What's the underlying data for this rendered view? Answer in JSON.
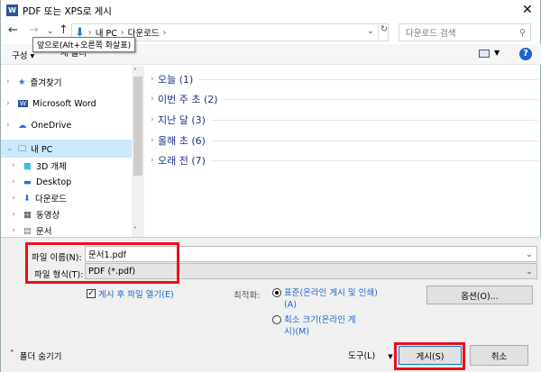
{
  "window": {
    "title": "PDF 또는 XPS로 게시",
    "close": "✕"
  },
  "nav": {
    "back": "←",
    "forward": "→",
    "recent": "⌄",
    "up": "↑",
    "path": [
      "내 PC",
      "다운로드"
    ],
    "refresh": "↻",
    "search_placeholder": "다운로드 검색",
    "tooltip": "앞으로(Alt+오른쪽 화살표)"
  },
  "toolbar": {
    "organize": "구성",
    "new_folder": "새 폴더"
  },
  "sidebar": {
    "items": [
      {
        "label": "즐겨찾기"
      },
      {
        "label": "Microsoft Word"
      },
      {
        "label": "OneDrive"
      },
      {
        "label": "내 PC"
      },
      {
        "label": "3D 개체"
      },
      {
        "label": "Desktop"
      },
      {
        "label": "다운로드"
      },
      {
        "label": "동영상"
      },
      {
        "label": "문서"
      }
    ]
  },
  "groups": [
    {
      "label": "오늘 (1)"
    },
    {
      "label": "이번 주 초 (2)"
    },
    {
      "label": "지난 달 (3)"
    },
    {
      "label": "올해 초 (6)"
    },
    {
      "label": "오래 전 (7)"
    }
  ],
  "form": {
    "filename_label": "파일 이름(N):",
    "filename_value": "문서1.pdf",
    "filetype_label": "파일 형식(T):",
    "filetype_value": "PDF (*.pdf)",
    "open_after_label": "게시 후 파일 열기(E)",
    "optimize_label": "최적화:",
    "opt_standard": "표준(온라인 게시 및 인쇄)(A)",
    "opt_minimum": "최소 크기(온라인 게시)(M)",
    "options_button": "옵션(O)..."
  },
  "footer": {
    "hide_folders": "폴더 숨기기",
    "tools": "도구(L)",
    "publish": "게시(S)",
    "cancel": "취소"
  },
  "colors": {
    "highlight": "#e8101c",
    "selection": "#cce8ff"
  }
}
